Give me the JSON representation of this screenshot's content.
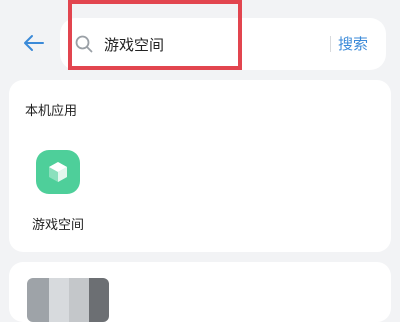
{
  "header": {
    "back_icon": "arrow-left-icon",
    "search_icon": "search-icon",
    "query": "游戏空间",
    "search_button_label": "搜索"
  },
  "local_apps": {
    "title": "本机应用",
    "items": [
      {
        "label": "游戏空间",
        "icon": "game-space-cube-icon",
        "icon_color": "#4ecf9a"
      }
    ]
  },
  "colors": {
    "accent": "#3b8ad8",
    "highlight_border": "#e2454f",
    "background": "#f2f3f5"
  }
}
